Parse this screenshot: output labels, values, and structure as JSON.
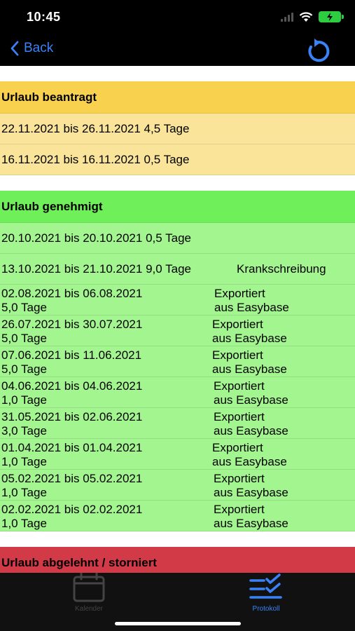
{
  "status": {
    "time": "10:45"
  },
  "nav": {
    "back_label": "Back"
  },
  "sections": {
    "beantragt": {
      "title": "Urlaub beantragt",
      "rows": [
        {
          "text": "22.11.2021 bis 26.11.2021 4,5 Tage"
        },
        {
          "text": "16.11.2021 bis 16.11.2021 0,5 Tage"
        }
      ]
    },
    "genehmigt": {
      "title": "Urlaub genehmigt",
      "rows": [
        {
          "text": "20.10.2021 bis 20.10.2021 0,5 Tage",
          "note": ""
        },
        {
          "text": "13.10.2021 bis 21.10.2021 9,0 Tage",
          "note": "Krankschreibung"
        }
      ],
      "export_rows": [
        {
          "range": "02.08.2021 bis 06.08.2021",
          "days": "5,0 Tage",
          "status1": "Exportiert",
          "status2": "aus Easybase"
        },
        {
          "range": "26.07.2021 bis 30.07.2021",
          "days": "5,0 Tage",
          "status1": "Exportiert",
          "status2": "aus Easybase"
        },
        {
          "range": "07.06.2021 bis 11.06.2021",
          "days": "5,0 Tage",
          "status1": "Exportiert",
          "status2": "aus Easybase"
        },
        {
          "range": "04.06.2021 bis 04.06.2021",
          "days": "1,0 Tage",
          "status1": "Exportiert",
          "status2": "aus Easybase"
        },
        {
          "range": "31.05.2021 bis 02.06.2021",
          "days": "3,0 Tage",
          "status1": "Exportiert",
          "status2": "aus Easybase"
        },
        {
          "range": "01.04.2021 bis 01.04.2021",
          "days": "1,0 Tage",
          "status1": "Exportiert",
          "status2": "aus Easybase"
        },
        {
          "range": "05.02.2021 bis 05.02.2021",
          "days": "1,0 Tage",
          "status1": "Exportiert",
          "status2": "aus Easybase"
        },
        {
          "range": "02.02.2021 bis 02.02.2021",
          "days": "1,0 Tage",
          "status1": "Exportiert",
          "status2": "aus Easybase"
        }
      ]
    },
    "abgelehnt": {
      "title": "Urlaub abgelehnt / storniert"
    }
  },
  "tabs": {
    "kalender": {
      "label": "Kalender",
      "icon": "calendar-icon"
    },
    "protokoll": {
      "label": "Protokoll",
      "icon": "checklist-icon"
    }
  },
  "colors": {
    "accent": "#3a82f7",
    "beantragt_header": "#f8d24e",
    "beantragt_row": "#f9e49a",
    "genehmigt_header": "#6ff05a",
    "genehmigt_row": "#a3f58f",
    "abgelehnt_header": "#d13a46"
  }
}
